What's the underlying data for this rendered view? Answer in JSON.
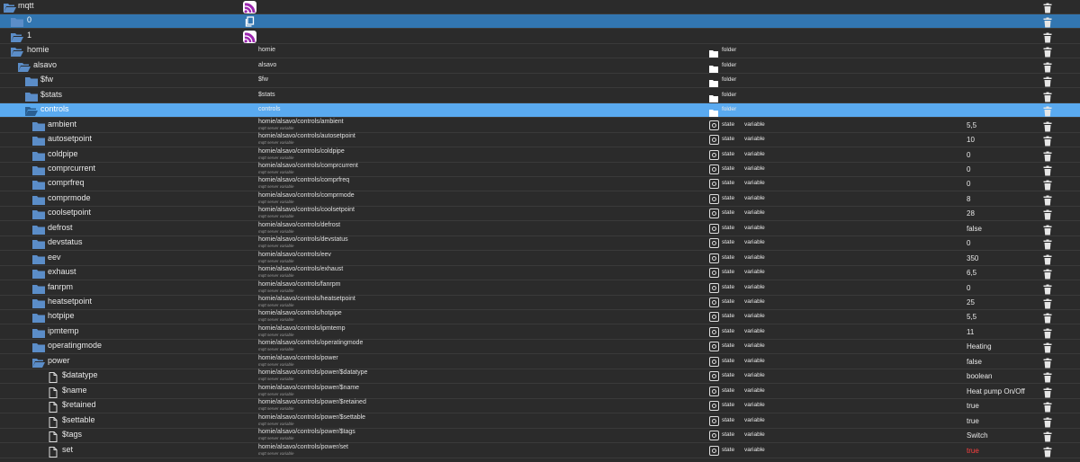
{
  "tree": {
    "rows": [
      {
        "name": "mqtt",
        "level": 0,
        "kind": "folder",
        "open": true,
        "id": "",
        "id_sub": "",
        "type": "",
        "role": "",
        "value": "",
        "badge": "wifi"
      },
      {
        "name": "0",
        "level": 1,
        "kind": "folder",
        "open": false,
        "id": "",
        "id_sub": "",
        "type": "",
        "role": "",
        "value": "",
        "badge": "copy",
        "selected": "dark"
      },
      {
        "name": "1",
        "level": 1,
        "kind": "folder",
        "open": true,
        "id": "",
        "id_sub": "",
        "type": "",
        "role": "",
        "value": "",
        "badge": "wifi"
      },
      {
        "name": "homie",
        "level": 2,
        "kind": "folder",
        "open": true,
        "id": "homie",
        "id_sub": "",
        "type": "folder",
        "role": "",
        "value": ""
      },
      {
        "name": "alsavo",
        "level": 3,
        "kind": "folder",
        "open": true,
        "id": "alsavo",
        "id_sub": "",
        "type": "folder",
        "role": "",
        "value": ""
      },
      {
        "name": "$fw",
        "level": 4,
        "kind": "folder",
        "open": false,
        "id": "$fw",
        "id_sub": "",
        "type": "folder",
        "role": "",
        "value": ""
      },
      {
        "name": "$stats",
        "level": 4,
        "kind": "folder",
        "open": false,
        "id": "$stats",
        "id_sub": "",
        "type": "folder",
        "role": "",
        "value": ""
      },
      {
        "name": "controls",
        "level": 4,
        "kind": "folder",
        "open": true,
        "id": "controls",
        "id_sub": "",
        "type": "folder",
        "role": "",
        "value": "",
        "selected": "light"
      },
      {
        "name": "ambient",
        "level": 5,
        "kind": "folder",
        "open": false,
        "id": "homie/alsavo/controls/ambient",
        "id_sub": "mqtt server variable",
        "type": "state",
        "role": "variable",
        "value": "5,5"
      },
      {
        "name": "autosetpoint",
        "level": 5,
        "kind": "folder",
        "open": false,
        "id": "homie/alsavo/controls/autosetpoint",
        "id_sub": "mqtt server variable",
        "type": "state",
        "role": "variable",
        "value": "10"
      },
      {
        "name": "coldpipe",
        "level": 5,
        "kind": "folder",
        "open": false,
        "id": "homie/alsavo/controls/coldpipe",
        "id_sub": "mqtt server variable",
        "type": "state",
        "role": "variable",
        "value": "0"
      },
      {
        "name": "comprcurrent",
        "level": 5,
        "kind": "folder",
        "open": false,
        "id": "homie/alsavo/controls/comprcurrent",
        "id_sub": "mqtt server variable",
        "type": "state",
        "role": "variable",
        "value": "0"
      },
      {
        "name": "comprfreq",
        "level": 5,
        "kind": "folder",
        "open": false,
        "id": "homie/alsavo/controls/comprfreq",
        "id_sub": "mqtt server variable",
        "type": "state",
        "role": "variable",
        "value": "0"
      },
      {
        "name": "comprmode",
        "level": 5,
        "kind": "folder",
        "open": false,
        "id": "homie/alsavo/controls/comprmode",
        "id_sub": "mqtt server variable",
        "type": "state",
        "role": "variable",
        "value": "8"
      },
      {
        "name": "coolsetpoint",
        "level": 5,
        "kind": "folder",
        "open": false,
        "id": "homie/alsavo/controls/coolsetpoint",
        "id_sub": "mqtt server variable",
        "type": "state",
        "role": "variable",
        "value": "28"
      },
      {
        "name": "defrost",
        "level": 5,
        "kind": "folder",
        "open": false,
        "id": "homie/alsavo/controls/defrost",
        "id_sub": "mqtt server variable",
        "type": "state",
        "role": "variable",
        "value": "false"
      },
      {
        "name": "devstatus",
        "level": 5,
        "kind": "folder",
        "open": false,
        "id": "homie/alsavo/controls/devstatus",
        "id_sub": "mqtt server variable",
        "type": "state",
        "role": "variable",
        "value": "0"
      },
      {
        "name": "eev",
        "level": 5,
        "kind": "folder",
        "open": false,
        "id": "homie/alsavo/controls/eev",
        "id_sub": "mqtt server variable",
        "type": "state",
        "role": "variable",
        "value": "350"
      },
      {
        "name": "exhaust",
        "level": 5,
        "kind": "folder",
        "open": false,
        "id": "homie/alsavo/controls/exhaust",
        "id_sub": "mqtt server variable",
        "type": "state",
        "role": "variable",
        "value": "6,5"
      },
      {
        "name": "fanrpm",
        "level": 5,
        "kind": "folder",
        "open": false,
        "id": "homie/alsavo/controls/fanrpm",
        "id_sub": "mqtt server variable",
        "type": "state",
        "role": "variable",
        "value": "0"
      },
      {
        "name": "heatsetpoint",
        "level": 5,
        "kind": "folder",
        "open": false,
        "id": "homie/alsavo/controls/heatsetpoint",
        "id_sub": "mqtt server variable",
        "type": "state",
        "role": "variable",
        "value": "25"
      },
      {
        "name": "hotpipe",
        "level": 5,
        "kind": "folder",
        "open": false,
        "id": "homie/alsavo/controls/hotpipe",
        "id_sub": "mqtt server variable",
        "type": "state",
        "role": "variable",
        "value": "5,5"
      },
      {
        "name": "ipmtemp",
        "level": 5,
        "kind": "folder",
        "open": false,
        "id": "homie/alsavo/controls/ipmtemp",
        "id_sub": "mqtt server variable",
        "type": "state",
        "role": "variable",
        "value": "11"
      },
      {
        "name": "operatingmode",
        "level": 5,
        "kind": "folder",
        "open": false,
        "id": "homie/alsavo/controls/operatingmode",
        "id_sub": "mqtt server variable",
        "type": "state",
        "role": "variable",
        "value": "Heating"
      },
      {
        "name": "power",
        "level": 5,
        "kind": "folder",
        "open": true,
        "id": "homie/alsavo/controls/power",
        "id_sub": "mqtt server variable",
        "type": "state",
        "role": "variable",
        "value": "false"
      },
      {
        "name": "$datatype",
        "level": 6,
        "kind": "file",
        "id": "homie/alsavo/controls/power/$datatype",
        "id_sub": "mqtt server variable",
        "type": "state",
        "role": "variable",
        "value": "boolean"
      },
      {
        "name": "$name",
        "level": 6,
        "kind": "file",
        "id": "homie/alsavo/controls/power/$name",
        "id_sub": "mqtt server variable",
        "type": "state",
        "role": "variable",
        "value": "Heat pump On/Off"
      },
      {
        "name": "$retained",
        "level": 6,
        "kind": "file",
        "id": "homie/alsavo/controls/power/$retained",
        "id_sub": "mqtt server variable",
        "type": "state",
        "role": "variable",
        "value": "true"
      },
      {
        "name": "$settable",
        "level": 6,
        "kind": "file",
        "id": "homie/alsavo/controls/power/$settable",
        "id_sub": "mqtt server variable",
        "type": "state",
        "role": "variable",
        "value": "true"
      },
      {
        "name": "$tags",
        "level": 6,
        "kind": "file",
        "id": "homie/alsavo/controls/power/$tags",
        "id_sub": "mqtt server variable",
        "type": "state",
        "role": "variable",
        "value": "Switch"
      },
      {
        "name": "set",
        "level": 6,
        "kind": "file",
        "id": "homie/alsavo/controls/power/set",
        "id_sub": "mqtt server variable",
        "type": "state",
        "role": "variable",
        "value": "true",
        "value_color": "#ff4040"
      }
    ]
  }
}
